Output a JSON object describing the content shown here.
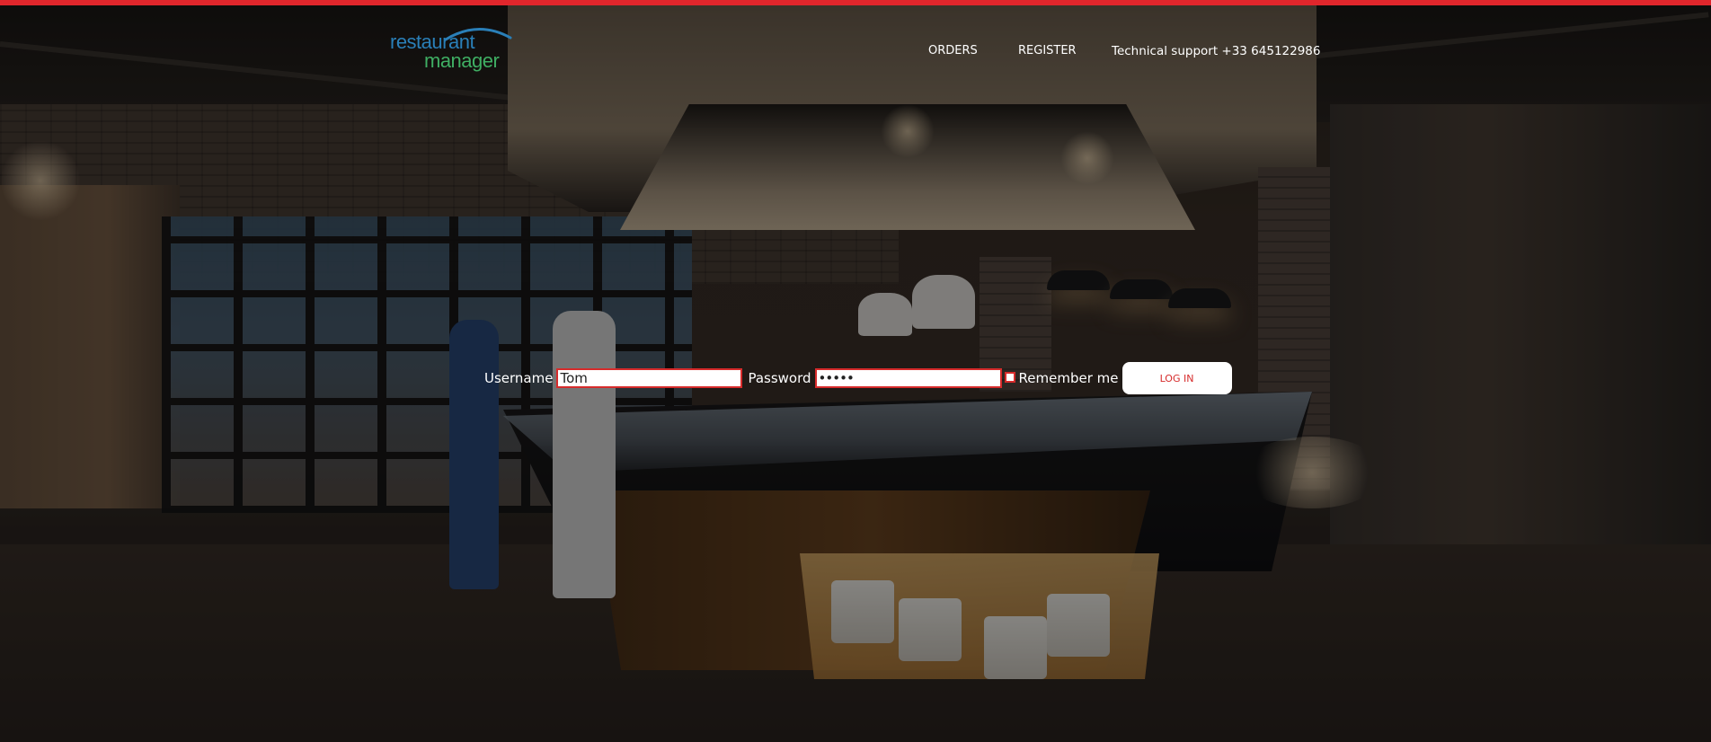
{
  "brand": {
    "line1": "restaurant",
    "line2": "manager",
    "colors": {
      "line1": "#2a7fb8",
      "line2": "#3fae63"
    }
  },
  "accent_color": "#e0262c",
  "nav": {
    "orders": "ORDERS",
    "register": "REGISTER",
    "support": "Technical support +33 645122986"
  },
  "login": {
    "username_label": "Username",
    "username_value": "Tom",
    "password_label": "Password",
    "password_value": "•••••",
    "remember_label": "Remember me",
    "remember_checked": false,
    "button_label": "LOG IN"
  }
}
